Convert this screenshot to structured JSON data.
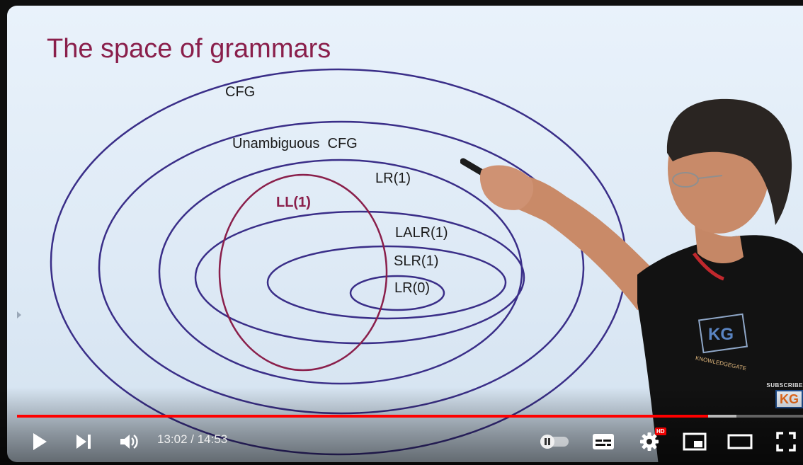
{
  "slide": {
    "title": "The space of grammars",
    "labels": {
      "cfg": "CFG",
      "unambiguous": "Unambiguous  CFG",
      "lr1": "LR(1)",
      "ll1": "LL(1)",
      "lalr1": "LALR(1)",
      "slr1": "SLR(1)",
      "lr0": "LR(0)"
    },
    "colors": {
      "ellipse": "#3a2e88",
      "ll1_ellipse": "#8a1f4b",
      "title": "#8a1f4b"
    }
  },
  "watermark": {
    "top_text": "SUBSCRIBE",
    "logo": "KG"
  },
  "presenter_shirt_logo": {
    "letters": "KG",
    "text": "KNOWLEDGEGATE"
  },
  "player": {
    "time_current": "13:02",
    "time_separator": " / ",
    "time_total": "14:53",
    "progress_played_fraction": 0.879,
    "progress_buffered_fraction": 0.915,
    "hd_badge": "HD",
    "colors": {
      "progress": "#ff0000"
    },
    "controls": [
      {
        "name": "play-icon"
      },
      {
        "name": "next-icon"
      },
      {
        "name": "volume-icon"
      },
      {
        "name": "autoplay-toggle-icon"
      },
      {
        "name": "subtitles-icon"
      },
      {
        "name": "settings-icon"
      },
      {
        "name": "miniplayer-icon"
      },
      {
        "name": "theater-mode-icon"
      },
      {
        "name": "fullscreen-icon"
      }
    ]
  }
}
